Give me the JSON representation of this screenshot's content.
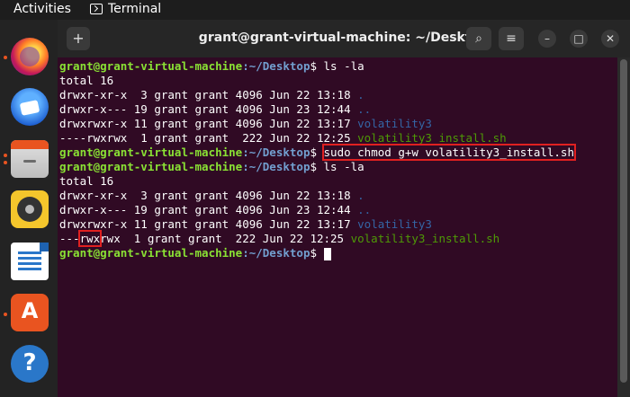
{
  "topbar": {
    "activities": "Activities",
    "app_name": "Terminal"
  },
  "dock": {
    "items": [
      {
        "name": "Firefox",
        "icon": "firefox-icon"
      },
      {
        "name": "Thunderbird Mail",
        "icon": "thunderbird-icon"
      },
      {
        "name": "Files",
        "icon": "files-icon"
      },
      {
        "name": "Rhythmbox",
        "icon": "rhythmbox-icon"
      },
      {
        "name": "LibreOffice Writer",
        "icon": "writer-icon"
      },
      {
        "name": "Ubuntu Software",
        "icon": "software-icon",
        "glyph": "A"
      },
      {
        "name": "Help",
        "icon": "help-icon",
        "glyph": "?"
      }
    ]
  },
  "window": {
    "title": "grant@grant-virtual-machine: ~/Desktop",
    "buttons": {
      "new_tab": "+",
      "search": "⌕",
      "menu": "≡",
      "minimize": "–",
      "maximize": "□",
      "close": "✕"
    }
  },
  "terminal": {
    "user_host": "grant@grant-virtual-machine",
    "path": "~/Desktop",
    "prompt_end": "$",
    "lines": {
      "l0_cmd": " ls -la",
      "l1": "total 16",
      "l2_text": "drwxr-xr-x  3 grant grant 4096 Jun 22 13:18 ",
      "l2_name": ".",
      "l3_text": "drwxr-x--- 19 grant grant 4096 Jun 23 12:44 ",
      "l3_name": "..",
      "l4_text": "drwxrwxr-x 11 grant grant 4096 Jun 22 13:17 ",
      "l4_name": "volatility3",
      "l5_text": "----rwxrwx  1 grant grant  222 Jun 22 12:25 ",
      "l5_name": "volatility3_install.sh",
      "l6_cmd": "sudo chmod g+w volatility3_install.sh",
      "l7_cmd": " ls -la",
      "l8": "total 16",
      "l9_text": "drwxr-xr-x  3 grant grant 4096 Jun 22 13:18 ",
      "l9_name": ".",
      "l10_text": "drwxr-x--- 19 grant grant 4096 Jun 23 12:44 ",
      "l10_name": "..",
      "l11_text": "drwxrwxr-x 11 grant grant 4096 Jun 22 13:17 ",
      "l11_name": "volatility3",
      "l12_pre": "---",
      "l12_hl": "rwx",
      "l12_rest": "rwx  1 grant grant  222 Jun 22 12:25 ",
      "l12_name": "volatility3_install.sh"
    }
  },
  "colors": {
    "terminal_bg": "#300a24",
    "prompt_user": "#8ae234",
    "prompt_path": "#729fcf",
    "directory": "#3465a4",
    "executable": "#4e9a06",
    "highlight_box": "#e02020",
    "ubuntu_orange": "#e95420"
  }
}
